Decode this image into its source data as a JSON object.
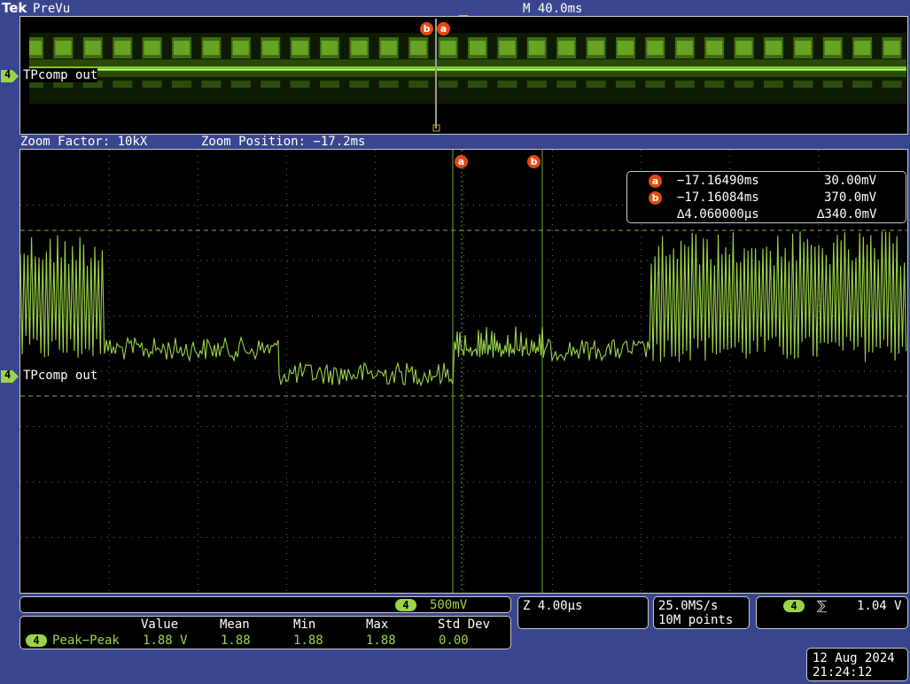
{
  "header": {
    "brand": "Tek",
    "mode": "PreVu",
    "timebase": "M 40.0ms"
  },
  "overview": {
    "channel_label": "TPcomp out",
    "channel_number": "4",
    "cursor_a": "a",
    "cursor_b": "b"
  },
  "zoom": {
    "factor_text": "Zoom Factor: 10kX",
    "position_text": "Zoom Position: −17.2ms"
  },
  "main": {
    "channel_label": "TPcomp out",
    "channel_number": "4",
    "cursor_a": "a",
    "cursor_b": "b"
  },
  "cursor_readout": {
    "a_label": "a",
    "b_label": "b",
    "a_time": "−17.16490ms",
    "a_volt": "30.00mV",
    "b_time": "−17.16084ms",
    "b_volt": "370.0mV",
    "delta_time": "∆4.060000µs",
    "delta_volt": "∆340.0mV"
  },
  "channel_scale": {
    "channel": "4",
    "volts_div": "500mV"
  },
  "measurement": {
    "headers": [
      "Value",
      "Mean",
      "Min",
      "Max",
      "Std Dev"
    ],
    "channel": "4",
    "name": "Peak−Peak",
    "values": [
      "1.88 V",
      "1.88",
      "1.88",
      "1.88",
      "0.00"
    ]
  },
  "horizontal": {
    "zoom_scale": "Z 4.00µs"
  },
  "acquisition": {
    "sample_rate": "25.0MS/s",
    "record_length": "10M points"
  },
  "trigger": {
    "channel": "4",
    "slope_symbol": "⅀",
    "level": "1.04 V"
  },
  "datetime": {
    "date": "12 Aug 2024",
    "time": "21:24:12"
  },
  "colors": {
    "background": "#39468f",
    "trace": "#9bd34a",
    "cursor": "#e34a12",
    "grid": "#6a6a6a"
  }
}
